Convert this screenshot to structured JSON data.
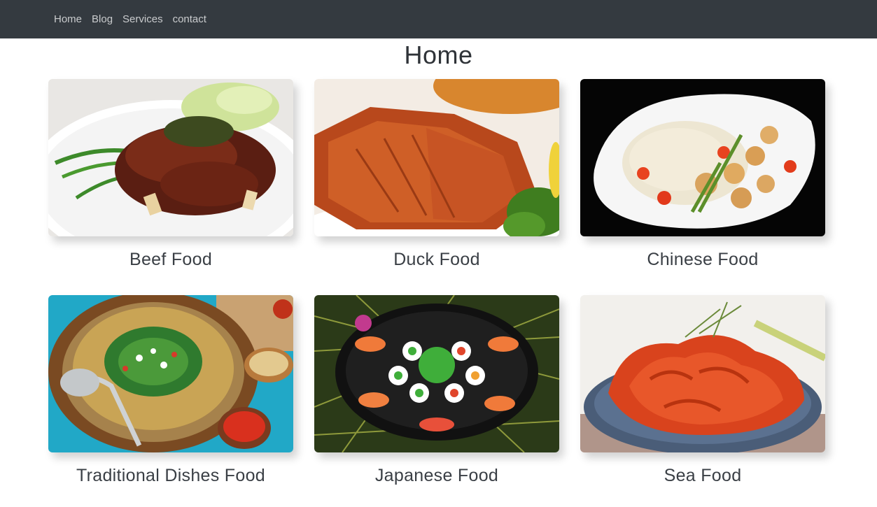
{
  "nav": {
    "items": [
      {
        "label": "Home"
      },
      {
        "label": "Blog"
      },
      {
        "label": "Services"
      },
      {
        "label": "contact"
      }
    ]
  },
  "page": {
    "title": "Home"
  },
  "cards": [
    {
      "caption": "Beef Food",
      "image": "beef-dish-photo"
    },
    {
      "caption": "Duck Food",
      "image": "roast-duck-photo"
    },
    {
      "caption": "Chinese Food",
      "image": "scallops-rice-photo"
    },
    {
      "caption": "Traditional Dishes Food",
      "image": "pasta-bowl-photo"
    },
    {
      "caption": "Japanese Food",
      "image": "sushi-platter-photo"
    },
    {
      "caption": "Sea Food",
      "image": "shrimp-plate-photo"
    }
  ],
  "colors": {
    "navbar": "#343a40",
    "nav_text": "#c9cbcd",
    "title_text": "#2f3338"
  }
}
